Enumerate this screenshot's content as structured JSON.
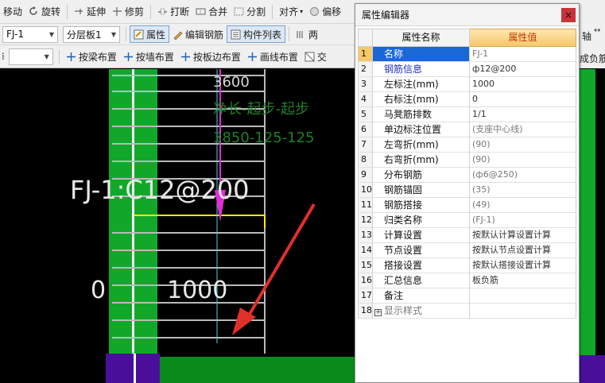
{
  "toolbar1": {
    "items": [
      "移动",
      "旋转",
      "延伸",
      "修剪",
      "打断",
      "合并",
      "分割",
      "对齐",
      "偏移"
    ]
  },
  "toolbar2": {
    "component_select": "FJ-1",
    "layer_select": "分层板1",
    "attr_button": "属性",
    "edit_rebar_button": "编辑钢筋",
    "component_list_button": "构件列表",
    "two_point_button": "两",
    "right_item": "轴"
  },
  "toolbar3": {
    "empty_select": "",
    "by_beam_button": "按梁布置",
    "by_wall_button": "按墙布置",
    "by_slab_edge_button": "按板边布置",
    "draw_line_button": "画线布置",
    "cross_button": "交",
    "right_item": "成负筋"
  },
  "canvas": {
    "length_label": "3600",
    "annotation_line1": "净长-起步-起步",
    "annotation_line2": "3850-125-125",
    "rebar_label": "FJ-1:C12@200",
    "left_mark": "0",
    "right_mark": "1000"
  },
  "panel": {
    "title": "属性编辑器",
    "close_label": "×",
    "header_name": "属性名称",
    "header_value": "属性值",
    "rows": [
      {
        "num": "1",
        "name": "名称",
        "value": "FJ-1"
      },
      {
        "num": "2",
        "name": "钢筋信息",
        "value": "ф12@200"
      },
      {
        "num": "3",
        "name": "左标注(mm)",
        "value": "1000"
      },
      {
        "num": "4",
        "name": "右标注(mm)",
        "value": "0"
      },
      {
        "num": "5",
        "name": "马凳筋排数",
        "value": "1/1"
      },
      {
        "num": "6",
        "name": "单边标注位置",
        "value": "(支座中心线)"
      },
      {
        "num": "7",
        "name": "左弯折(mm)",
        "value": "(90)"
      },
      {
        "num": "8",
        "name": "右弯折(mm)",
        "value": "(90)"
      },
      {
        "num": "9",
        "name": "分布钢筋",
        "value": "(ф6@250)"
      },
      {
        "num": "10",
        "name": "钢筋锚固",
        "value": "(35)"
      },
      {
        "num": "11",
        "name": "钢筋搭接",
        "value": "(49)"
      },
      {
        "num": "12",
        "name": "归类名称",
        "value": "(FJ-1)"
      },
      {
        "num": "13",
        "name": "计算设置",
        "value": "按默认计算设置计算"
      },
      {
        "num": "14",
        "name": "节点设置",
        "value": "按默认节点设置计算"
      },
      {
        "num": "15",
        "name": "搭接设置",
        "value": "按默认搭接设置计算"
      },
      {
        "num": "16",
        "name": "汇总信息",
        "value": "板负筋"
      },
      {
        "num": "17",
        "name": "备注",
        "value": ""
      },
      {
        "num": "18",
        "name": "显示样式",
        "value": ""
      }
    ],
    "expand_symbol": "+"
  },
  "colors": {
    "canvas_bg": "#000000",
    "wall_green": "#11a82a",
    "support_purple": "#4a0f9a",
    "rebar_magenta": "#e52bd6",
    "annotation_green": "#1f7f2a",
    "selection_blue": "#1a67d6",
    "header_orange": "#f6c86a",
    "close_red": "#c6343a"
  }
}
